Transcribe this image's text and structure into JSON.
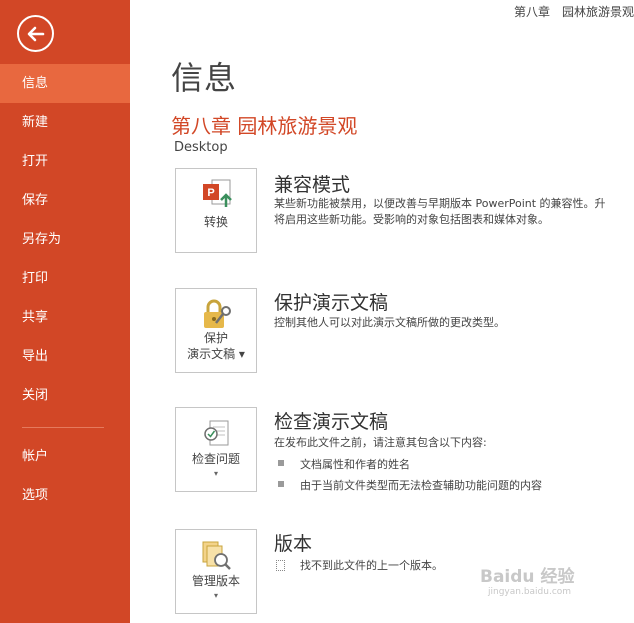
{
  "window": {
    "doc_title": "第八章　园林旅游景观"
  },
  "sidebar": {
    "back_label": "",
    "items": [
      {
        "label": "信息",
        "active": true
      },
      {
        "label": "新建"
      },
      {
        "label": "打开"
      },
      {
        "label": "保存"
      },
      {
        "label": "另存为"
      },
      {
        "label": "打印"
      },
      {
        "label": "共享"
      },
      {
        "label": "导出"
      },
      {
        "label": "关闭"
      },
      {
        "label": "帐户"
      },
      {
        "label": "选项"
      }
    ]
  },
  "main": {
    "title": "信息",
    "doc_name": "第八章  园林旅游景观",
    "location": "Desktop",
    "sections": [
      {
        "tile_label": "转换",
        "title": "兼容模式",
        "text_line1": "某些新功能被禁用，以便改善与早期版本 PowerPoint 的兼容性。升",
        "text_line2": "将启用这些新功能。受影响的对象包括图表和媒体对象。"
      },
      {
        "tile_label_line1": "保护",
        "tile_label_line2": "演示文稿 ▾",
        "title": "保护演示文稿",
        "text_line1": "控制其他人可以对此演示文稿所做的更改类型。"
      },
      {
        "tile_label": "检查问题",
        "caret": "▾",
        "title": "检查演示文稿",
        "text_line1": "在发布此文件之前，请注意其包含以下内容:",
        "bullets": [
          "文档属性和作者的姓名",
          "由于当前文件类型而无法检查辅助功能问题的内容"
        ]
      },
      {
        "tile_label": "管理版本",
        "caret": "▾",
        "title": "版本",
        "text_line1": "找不到此文件的上一个版本。"
      }
    ]
  },
  "watermark": {
    "text": "Baidu 经验",
    "url": "jingyan.baidu.com"
  },
  "colors": {
    "accent": "#d24726",
    "active_item": "#e8683f"
  }
}
